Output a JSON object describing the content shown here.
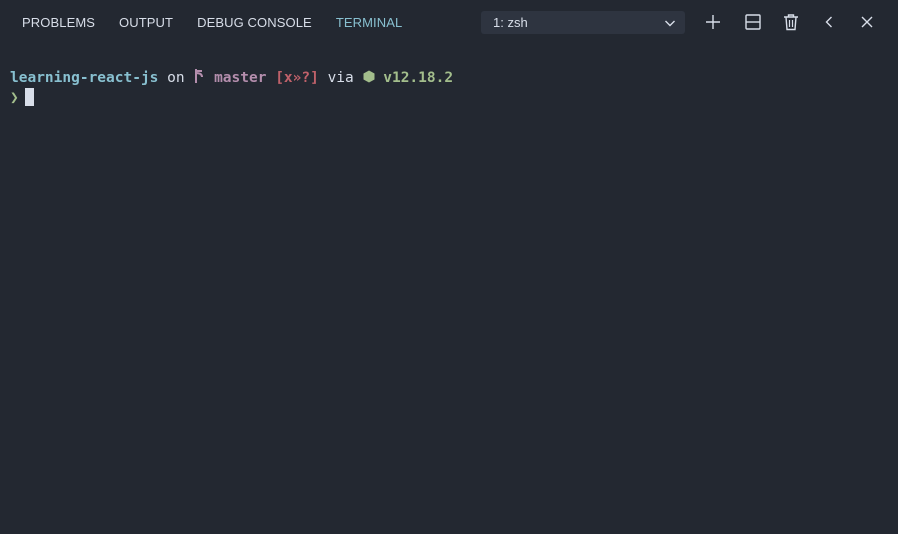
{
  "panel": {
    "tabs": [
      {
        "label": "PROBLEMS",
        "active": false
      },
      {
        "label": "OUTPUT",
        "active": false
      },
      {
        "label": "DEBUG CONSOLE",
        "active": false
      },
      {
        "label": "TERMINAL",
        "active": true
      }
    ],
    "terminal_select": {
      "value": "1: zsh",
      "icon": "chevron-down-icon"
    },
    "actions": [
      {
        "icon": "plus-icon"
      },
      {
        "icon": "split-terminal-icon"
      },
      {
        "icon": "trash-icon"
      },
      {
        "icon": "chevron-left-icon"
      },
      {
        "icon": "close-icon"
      }
    ]
  },
  "terminal": {
    "directory": "learning-react-js",
    "on_word": " on ",
    "branch_icon": "git-branch-icon",
    "branch": "master",
    "git_status": "[x»?]",
    "via_word": " via ",
    "node_icon": "nodejs-icon",
    "node_version": "v12.18.2",
    "prompt_symbol": "❯"
  },
  "colors": {
    "background": "#232831",
    "text": "#d8dee9",
    "active_tab": "#88c0d0",
    "directory": "#88c0d0",
    "branch": "#b48ead",
    "git_status": "#bf616a",
    "node": "#a3be8c"
  }
}
